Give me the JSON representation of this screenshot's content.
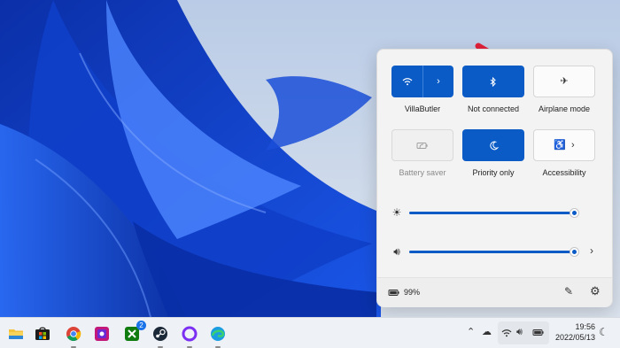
{
  "quick_settings": {
    "tiles": [
      {
        "label": "VillaButler",
        "icon": "wifi-icon",
        "state": "on",
        "split": true
      },
      {
        "label": "Not connected",
        "icon": "bluetooth-icon",
        "state": "on",
        "split": false
      },
      {
        "label": "Airplane mode",
        "icon": "airplane-icon",
        "state": "off",
        "split": false
      },
      {
        "label": "Battery saver",
        "icon": "battery-saver-icon",
        "state": "disabled",
        "split": false
      },
      {
        "label": "Priority only",
        "icon": "moon-icon",
        "state": "on",
        "split": false
      },
      {
        "label": "Accessibility",
        "icon": "accessibility-icon",
        "state": "off",
        "split": true
      }
    ],
    "brightness": {
      "icon": "brightness-icon",
      "value": 1.0
    },
    "volume": {
      "icon": "speaker-icon",
      "value": 1.0
    },
    "battery_percent": "99%"
  },
  "taskbar": {
    "apps": [
      {
        "name": "file-explorer"
      },
      {
        "name": "microsoft-store"
      },
      {
        "name": "chrome"
      },
      {
        "name": "app-tile-purple"
      },
      {
        "name": "xbox",
        "badge": "2"
      },
      {
        "name": "steam"
      },
      {
        "name": "circle-app"
      },
      {
        "name": "edge"
      }
    ],
    "time": "19:56",
    "date": "2022/05/13"
  },
  "colors": {
    "accent": "#0a5bc6",
    "arrow": "#e0213a"
  }
}
